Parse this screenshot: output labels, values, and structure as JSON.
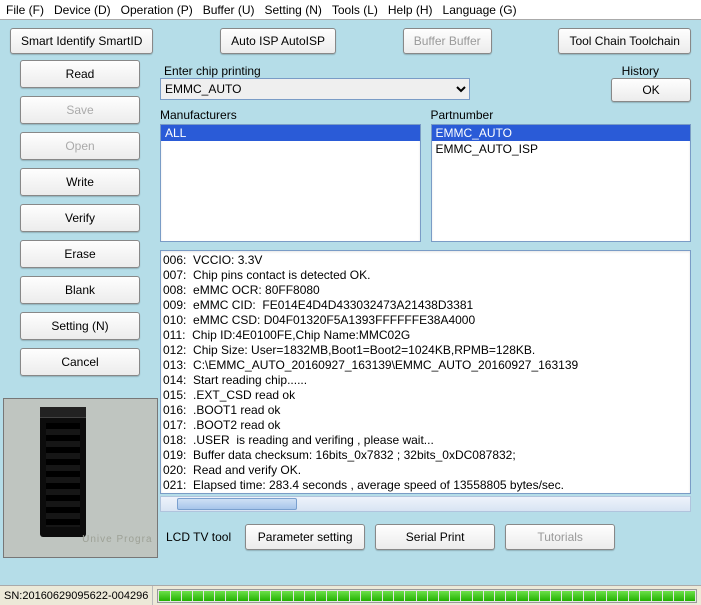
{
  "menu": {
    "file": "File (F)",
    "device": "Device (D)",
    "operation": "Operation (P)",
    "buffer": "Buffer (U)",
    "setting": "Setting (N)",
    "tools": "Tools (L)",
    "help": "Help (H)",
    "language": "Language (G)"
  },
  "topButtons": {
    "smartid": "Smart Identify SmartID",
    "autoisp": "Auto ISP AutoISP",
    "bufferbtn": "Buffer Buffer",
    "toolchain": "Tool Chain Toolchain"
  },
  "sideButtons": {
    "read": "Read",
    "save": "Save",
    "open": "Open",
    "write": "Write",
    "verify": "Verify",
    "erase": "Erase",
    "blank": "Blank",
    "setting": "Setting (N)",
    "cancel": "Cancel"
  },
  "photoLabel": "Unive\nProgra",
  "chip": {
    "enterLabel": "Enter chip printing",
    "historyLabel": "History",
    "comboValue": "EMMC_AUTO",
    "okLabel": "OK"
  },
  "lists": {
    "manufacturersLabel": "Manufacturers",
    "manufacturers": [
      "ALL"
    ],
    "partnumberLabel": "Partnumber",
    "partnumbers": [
      "EMMC_AUTO",
      "EMMC_AUTO_ISP"
    ]
  },
  "log": [
    "006:  VCCIO: 3.3V",
    "007:  Chip pins contact is detected OK.",
    "008:  eMMC OCR: 80FF8080",
    "009:  eMMC CID:  FE014E4D4D433032473A21438D3381",
    "010:  eMMC CSD: D04F01320F5A1393FFFFFFE38A4000",
    "011:  Chip ID:4E0100FE,Chip Name:MMC02G",
    "012:  Chip Size: User=1832MB,Boot1=Boot2=1024KB,RPMB=128KB.",
    "013:  C:\\EMMC_AUTO_20160927_163139\\EMMC_AUTO_20160927_163139",
    "014:  Start reading chip......",
    "015:  .EXT_CSD read ok",
    "016:  .BOOT1 read ok",
    "017:  .BOOT2 read ok",
    "018:  .USER  is reading and verifing , please wait...",
    "019:  Buffer data checksum: 16bits_0x7832 ; 32bits_0xDC087832;",
    "020:  Read and verify OK.",
    "021:  Elapsed time: 283.4 seconds , average speed of 13558805 bytes/sec."
  ],
  "bottom": {
    "lcd": "LCD TV tool",
    "param": "Parameter setting",
    "serial": "Serial Print",
    "tutorials": "Tutorials"
  },
  "status": {
    "sn": "SN:20160629095622-004296"
  }
}
